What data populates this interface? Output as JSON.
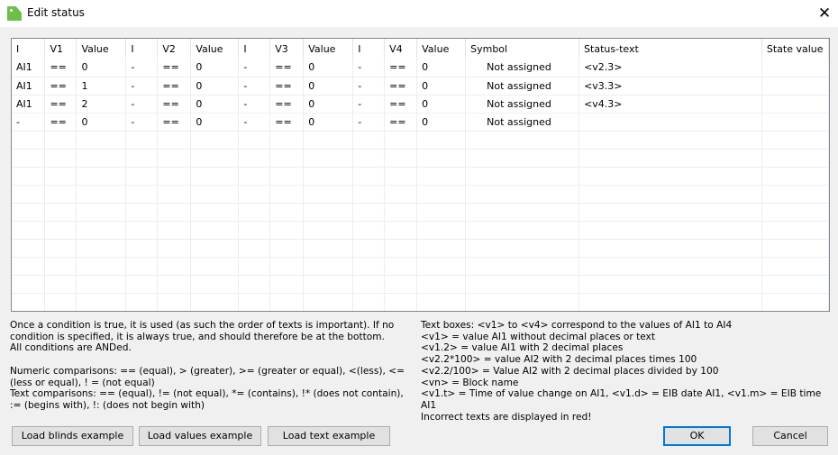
{
  "window": {
    "title": "Edit status",
    "close": "✕"
  },
  "table": {
    "columns": [
      "I",
      "V1",
      "Value",
      "I",
      "V2",
      "Value",
      "I",
      "V3",
      "Value",
      "I",
      "V4",
      "Value",
      "Symbol",
      "Status-text",
      "State value"
    ],
    "rows": [
      [
        "AI1",
        "==",
        "0",
        "-",
        "==",
        "0",
        "-",
        "==",
        "0",
        "-",
        "==",
        "0",
        "Not assigned",
        "<v2.3>",
        ""
      ],
      [
        "AI1",
        "==",
        "1",
        "-",
        "==",
        "0",
        "-",
        "==",
        "0",
        "-",
        "==",
        "0",
        "Not assigned",
        "<v3.3>",
        ""
      ],
      [
        "AI1",
        "==",
        "2",
        "-",
        "==",
        "0",
        "-",
        "==",
        "0",
        "-",
        "==",
        "0",
        "Not assigned",
        "<v4.3>",
        ""
      ],
      [
        "-",
        "==",
        "0",
        "-",
        "==",
        "0",
        "-",
        "==",
        "0",
        "-",
        "==",
        "0",
        "Not assigned",
        "",
        ""
      ]
    ]
  },
  "help_left": [
    "Once a condition is true, it is used (as such the order of texts is important). If no condition is specified, it is always true, and should therefore be at the bottom.",
    "All conditions are ANDed.",
    "",
    "Numeric comparisons: == (equal), > (greater), >= (greater or equal), <(less), <= (less or equal), ! = (not equal)",
    "Text comparisons: == (equal), != (not equal), *= (contains), !* (does not contain), := (begins with), !: (does not begin with)"
  ],
  "help_right": [
    "Text boxes: <v1> to <v4> correspond to the values of AI1 to AI4",
    "<v1> = value AI1 without decimal places or text",
    "<v1.2> = value AI1 with 2 decimal places",
    "<v2.2*100> = value AI2 with 2 decimal places times 100",
    "<v2.2/100> = Value AI2 with 2 decimal places divided by 100",
    "<vn> = Block name",
    "<v1.t> = Time of value change on AI1, <v1.d> = EIB date AI1, <v1.m> = EIB time AI1",
    "Incorrect texts are displayed in red!"
  ],
  "buttons": {
    "load_blinds": "Load blinds example",
    "load_values": "Load values example",
    "load_text": "Load text example",
    "ok": "OK",
    "cancel": "Cancel"
  }
}
